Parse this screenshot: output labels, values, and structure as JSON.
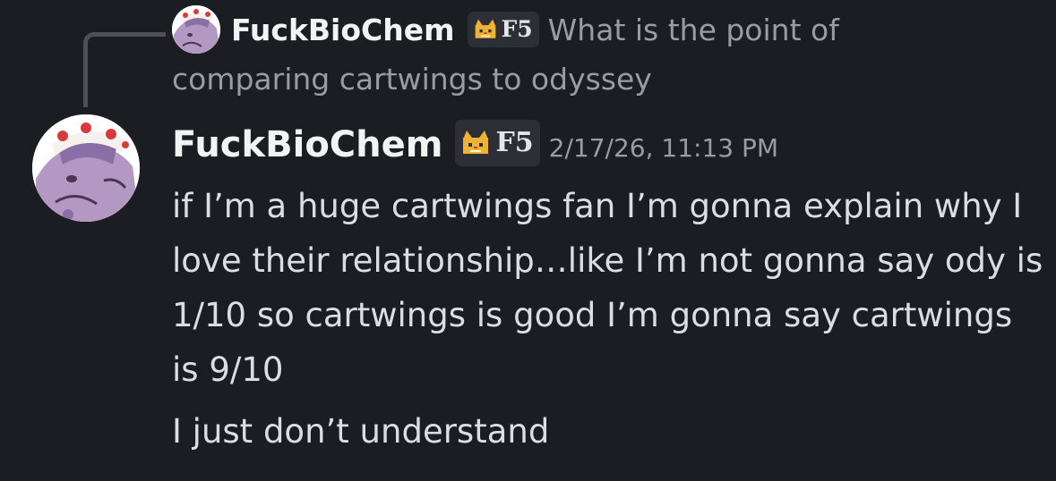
{
  "replied_message": {
    "author": "FuckBioChem",
    "tag": {
      "icon": "cat-icon",
      "label": "F5"
    },
    "preview_line1": "What is the point of",
    "preview_line2": "comparing cartwings to odyssey"
  },
  "message": {
    "author": "FuckBioChem",
    "tag": {
      "icon": "cat-icon",
      "label": "F5"
    },
    "timestamp": "2/17/26, 11:13 PM",
    "paragraphs": [
      "if I’m a huge cartwings fan I’m gonna explain why I love their relationship…like I’m not gonna say ody is 1/10 so cartwings is good I’m gonna say cartwings is 9/10",
      "I just don’t understand"
    ]
  },
  "colors": {
    "background": "#1c1d22",
    "username": "#f2f3f5",
    "muted": "#9a9ca4",
    "text": "#dbdee1",
    "tag_bg": "#2d2f36",
    "reply_spine": "#4e5058"
  }
}
